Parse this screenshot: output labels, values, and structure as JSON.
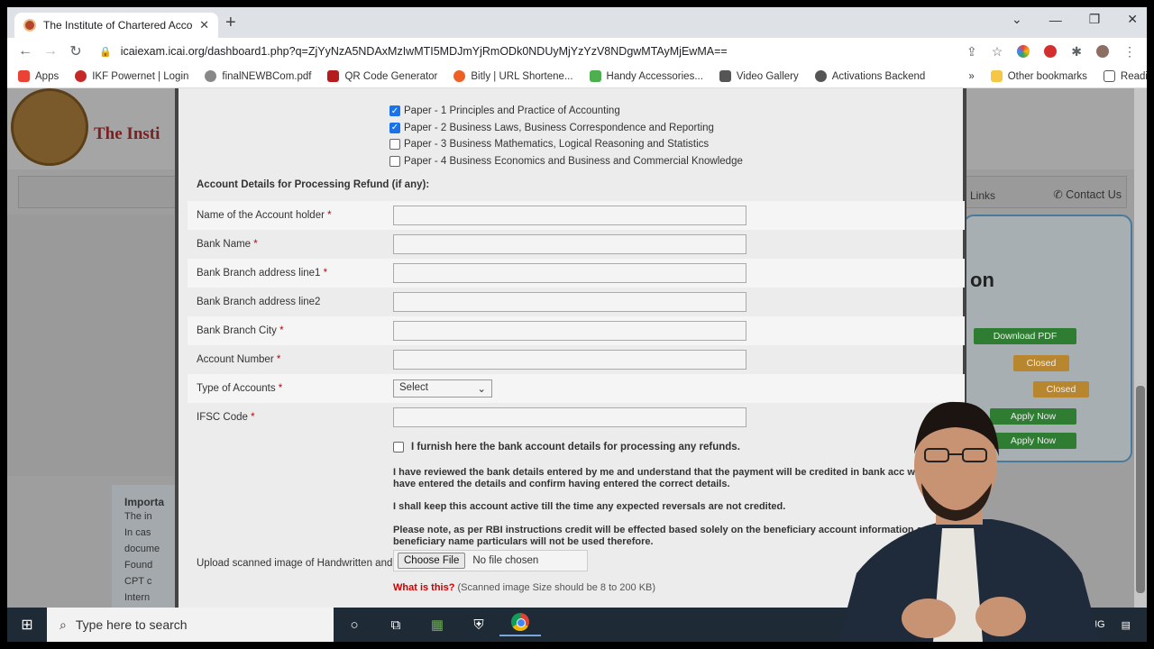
{
  "browser": {
    "tab_title": "The Institute of Chartered Accou",
    "url": "icaiexam.icai.org/dashboard1.php?q=ZjYyNzA5NDAxMzIwMTI5MDJmYjRmODk0NDUyMjYzYzV8NDgwMTAyMjEwMA=="
  },
  "bookmarks": [
    {
      "label": "Apps",
      "icon": "apps-grid-icon",
      "color": "#ea4335"
    },
    {
      "label": "IKF Powernet | Login",
      "icon": "ikf-icon",
      "color": "#c62828"
    },
    {
      "label": "finalNEWBCom.pdf",
      "icon": "pdf-icon",
      "color": "#888888"
    },
    {
      "label": "QR Code Generator",
      "icon": "qr-icon",
      "color": "#b71c1c"
    },
    {
      "label": "Bitly | URL Shortene...",
      "icon": "bitly-icon",
      "color": "#ee6123"
    },
    {
      "label": "Handy Accessories...",
      "icon": "handy-icon",
      "color": "#4caf50"
    },
    {
      "label": "Video Gallery",
      "icon": "video-icon",
      "color": "#555555"
    },
    {
      "label": "Activations Backend",
      "icon": "globe-icon",
      "color": "#555555"
    }
  ],
  "bookmarks_right": {
    "more": "»",
    "other": "Other bookmarks",
    "reading": "Reading list"
  },
  "background_page": {
    "title": "The Insti",
    "nav_links": "Links",
    "contact": "Contact Us",
    "heading_fragment": "on",
    "buttons": [
      {
        "label": "Download PDF",
        "color": "#2e7d32"
      },
      {
        "label": "Closed",
        "color": "#b8862e"
      },
      {
        "label": "Closed",
        "color": "#b8862e"
      },
      {
        "label": "Apply Now",
        "color": "#2e7d32"
      },
      {
        "label": "Apply Now",
        "color": "#2e7d32"
      }
    ],
    "important_title": "Importa",
    "important_items": [
      "The in",
      "In cas",
      "docume",
      "Found",
      "CPT c",
      "Intern"
    ]
  },
  "form": {
    "papers": [
      {
        "label": "Paper - 1 Principles and Practice of Accounting",
        "checked": true
      },
      {
        "label": "Paper - 2 Business Laws, Business Correspondence and Reporting",
        "checked": true
      },
      {
        "label": "Paper - 3 Business Mathematics, Logical Reasoning and Statistics",
        "checked": false
      },
      {
        "label": "Paper - 4 Business Economics and Business and Commercial Knowledge",
        "checked": false
      }
    ],
    "section_title": "Account Details for Processing Refund (if any):",
    "fields": {
      "account_holder": "Name of the Account holder",
      "bank_name": "Bank Name",
      "addr1": "Bank Branch address line1",
      "addr2": "Bank Branch address line2",
      "city": "Bank Branch City",
      "account_number": "Account Number",
      "account_type": "Type of Accounts",
      "ifsc": "IFSC Code"
    },
    "required_marker": "*",
    "account_type_value": "Select",
    "furnish_text": "I furnish here the bank account details for processing any refunds.",
    "notes": [
      "I have reviewed the bank details entered by me and understand that the payment will be credited in bank acc which I have entered the details and confirm having entered the correct details.",
      "I shall keep this account active till the time any expected reversals are not credited.",
      "Please note, as per RBI instructions credit will be effected based solely on the beneficiary account information and the beneficiary name particulars will not be used therefore."
    ],
    "upload_label": "Upload scanned image of Handwritten and signed application",
    "choose_file": "Choose File",
    "no_file": "No file chosen",
    "what_is_this": "What is this?",
    "size_hint": "(Scanned image Size should be 8 to 200 KB)"
  },
  "taskbar": {
    "search_placeholder": "Type here to search",
    "lang": "NG"
  }
}
